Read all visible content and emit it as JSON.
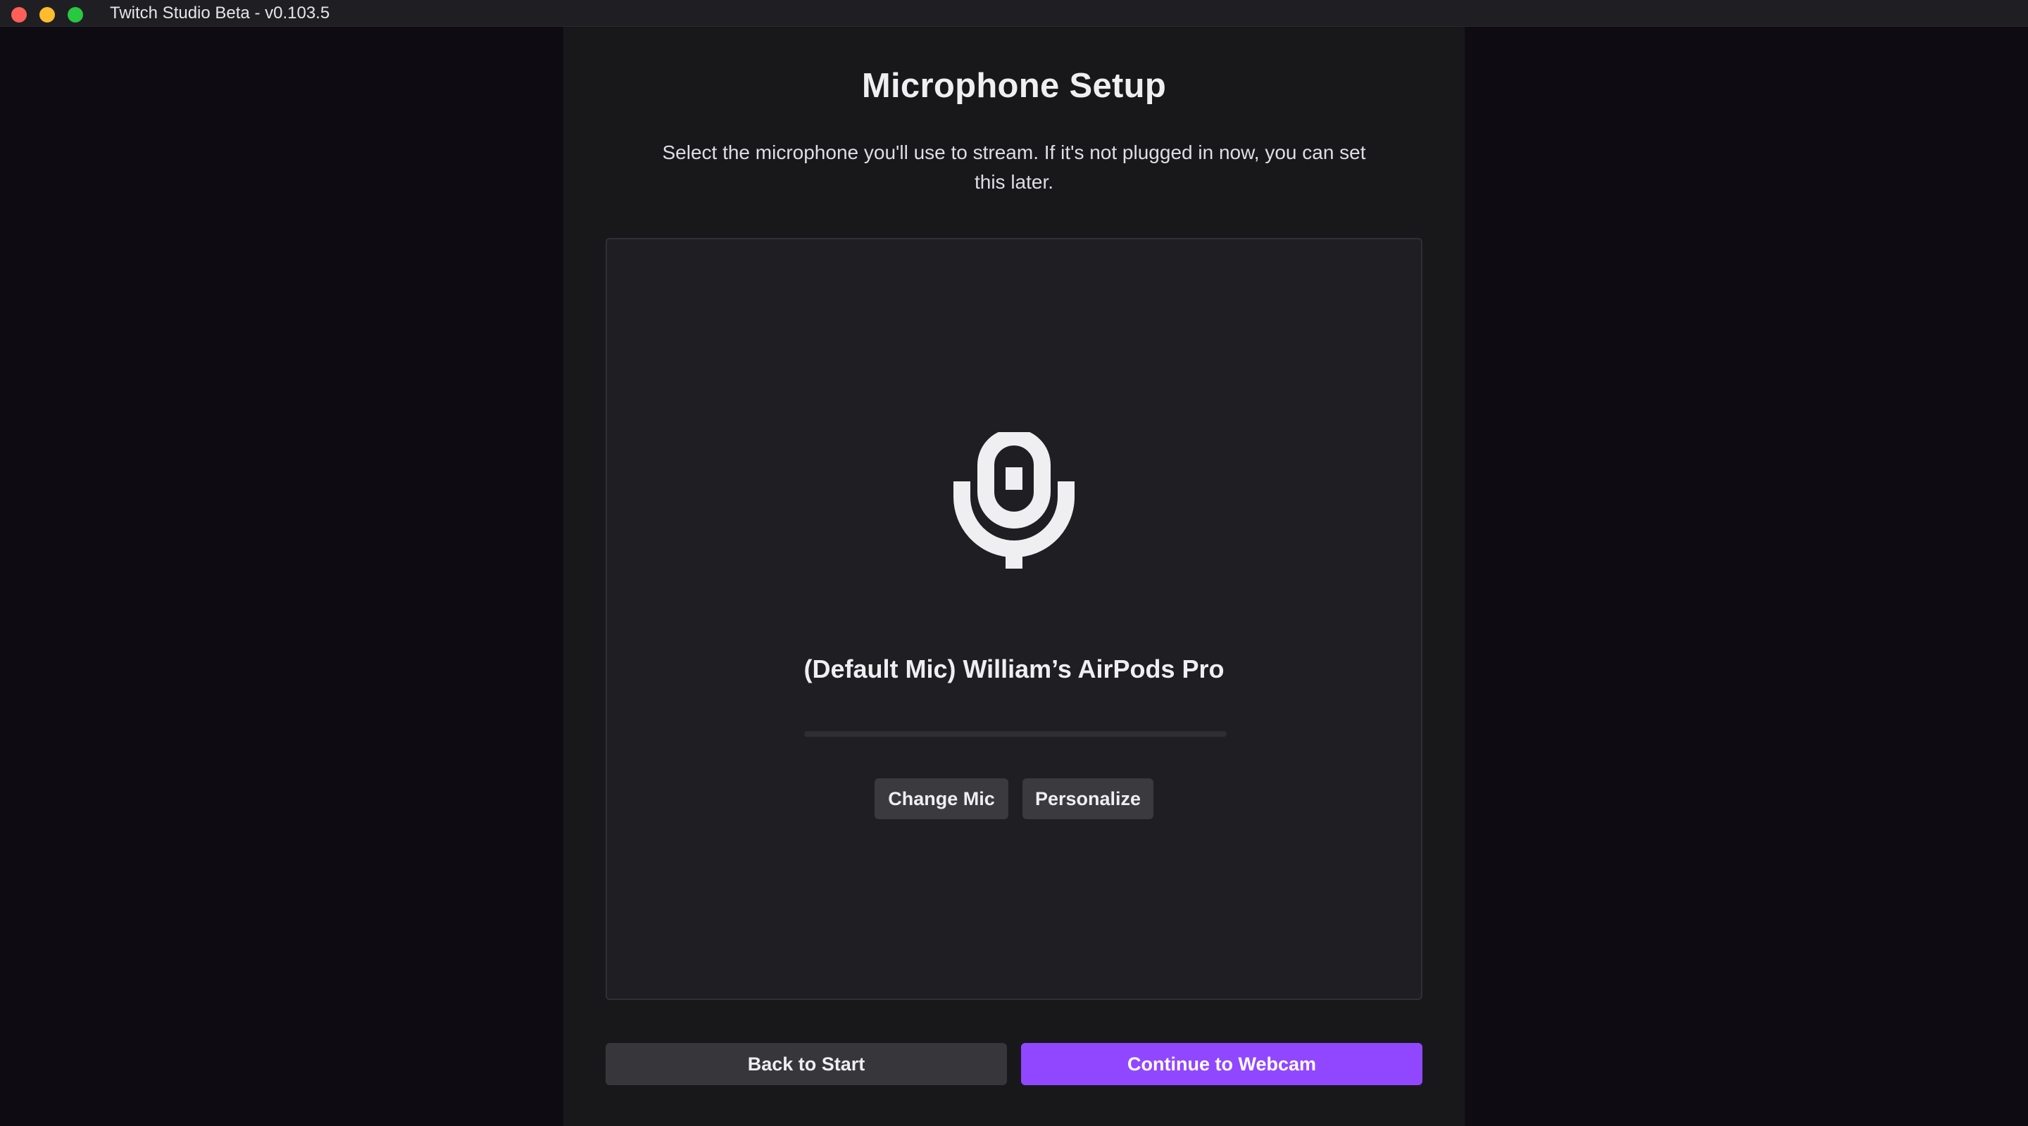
{
  "window": {
    "title": "Twitch Studio Beta - v0.103.5"
  },
  "header": {
    "title": "Microphone Setup",
    "subtitle_line1": "Select the microphone you'll use to stream. If it's not plugged in now, you can set",
    "subtitle_line2": "this later."
  },
  "mic_card": {
    "icon": "microphone-icon",
    "device_name": "(Default Mic) William’s AirPods Pro",
    "level_percent": 0,
    "change_button": "Change Mic",
    "personalize_button": "Personalize"
  },
  "footer": {
    "back_button": "Back to Start",
    "continue_button": "Continue to Webcam"
  },
  "colors": {
    "accent": "#9147ff",
    "background": "#0e0c12",
    "panel": "#18181b",
    "card": "#1f1f23"
  }
}
